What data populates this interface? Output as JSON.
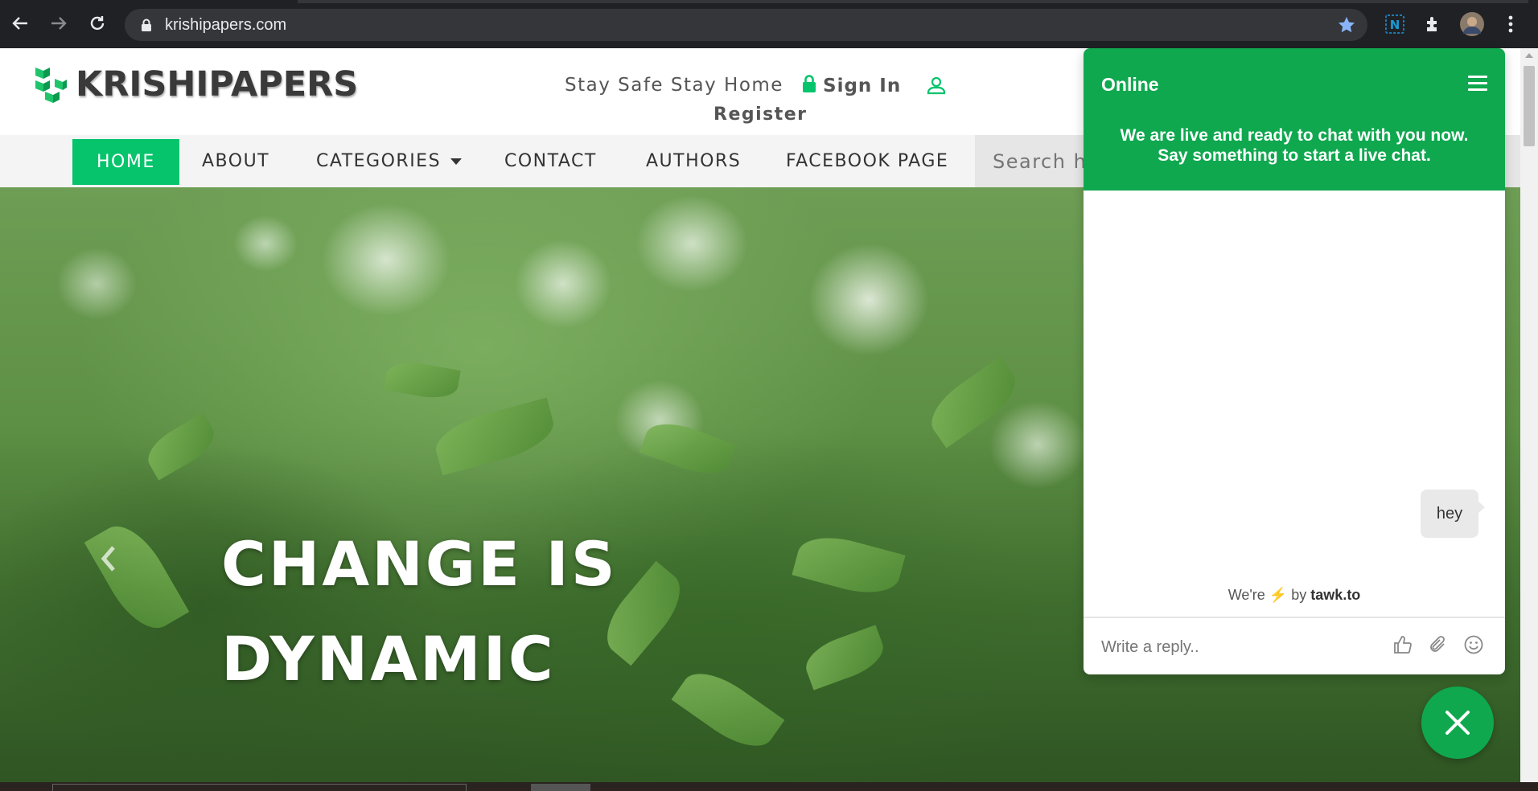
{
  "browser": {
    "url": "krishipapers.com"
  },
  "header": {
    "logo_text": "KRISHIPAPERS",
    "tagline": "Stay Safe Stay Home",
    "signin_label": "Sign In",
    "register_label": "Register"
  },
  "nav": {
    "items": [
      {
        "label": "HOME"
      },
      {
        "label": "ABOUT"
      },
      {
        "label": "CATEGORIES"
      },
      {
        "label": "CONTACT"
      },
      {
        "label": "AUTHORS"
      },
      {
        "label": "FACEBOOK PAGE"
      }
    ],
    "search_placeholder": "Search here..."
  },
  "hero": {
    "title_line1": "CHANGE IS",
    "title_line2": "DYNAMIC"
  },
  "chat": {
    "status": "Online",
    "welcome": "We are live and ready to chat with you now. Say something to start a live chat.",
    "messages": [
      {
        "text": "hey"
      }
    ],
    "powered_prefix": "We're",
    "powered_by": "by",
    "powered_brand": "tawk.to",
    "reply_placeholder": "Write a reply.."
  },
  "colors": {
    "brand_green": "#05c46b",
    "chat_green": "#0fa84f",
    "browser_bg": "#202124"
  }
}
